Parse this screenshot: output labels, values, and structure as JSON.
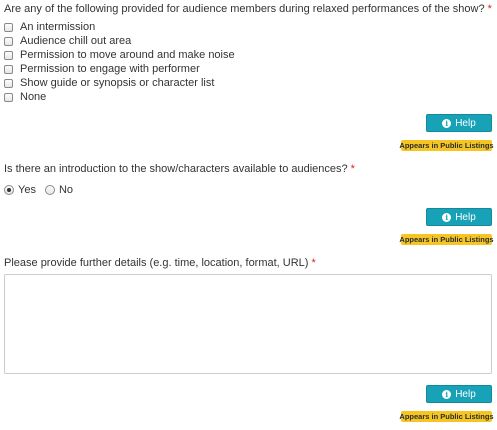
{
  "q1": {
    "label": "Are any of the following provided for audience members during relaxed performances of the show?",
    "required": "*",
    "options": [
      "An intermission",
      "Audience chill out area",
      "Permission to move around and make noise",
      "Permission to engage with performer",
      "Show guide or synopsis or character list",
      "None"
    ]
  },
  "q2": {
    "label": "Is there an introduction to the show/characters available to audiences?",
    "required": "*",
    "options": [
      "Yes",
      "No"
    ],
    "selected": "Yes"
  },
  "q3": {
    "label": "Please provide further details (e.g. time, location, format, URL)",
    "required": "*",
    "value": ""
  },
  "help": {
    "label": "Help",
    "icon": "info-icon"
  },
  "badge": {
    "label": "Appears in Public Listings",
    "color": "#f5c623"
  },
  "colors": {
    "accent": "#17a2b8",
    "required": "#d9231d"
  }
}
